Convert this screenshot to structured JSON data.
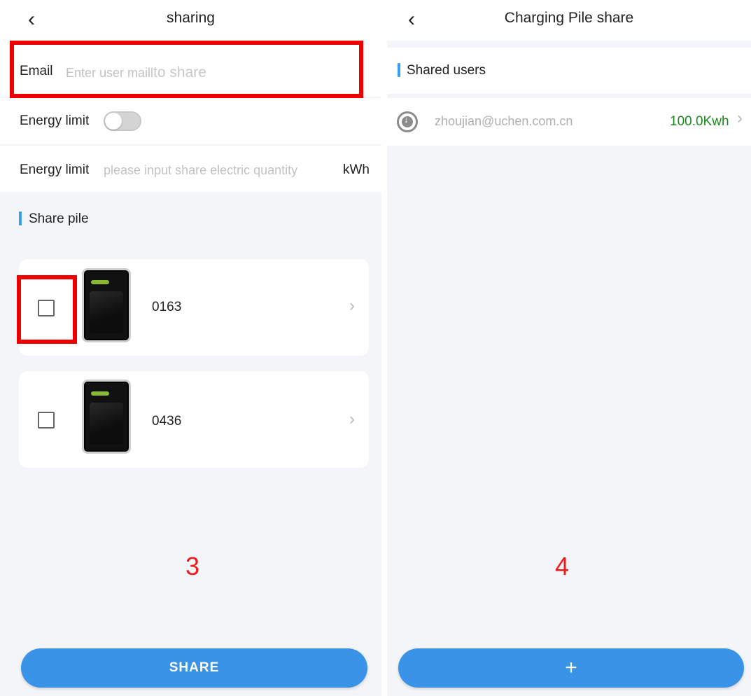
{
  "left_screen": {
    "nav": {
      "back_icon": "chevron-left-icon",
      "title": "sharing"
    },
    "email": {
      "label": "Email",
      "placeholder_small": "Enter user maill",
      "placeholder_large": "to share"
    },
    "energy_toggle": {
      "label": "Energy limit",
      "on": false
    },
    "energy_input": {
      "label": "Energy limit",
      "placeholder": "please input share electric quantity",
      "unit": "kWh"
    },
    "section_title": "Share pile",
    "piles": [
      {
        "code": "0163",
        "checked": false
      },
      {
        "code": "0436",
        "checked": false
      }
    ],
    "step_number": "3",
    "share_button": "SHARE"
  },
  "right_screen": {
    "nav": {
      "back_icon": "chevron-left-icon",
      "title": "Charging Pile share"
    },
    "section_title": "Shared users",
    "users": [
      {
        "icon": "plug-icon",
        "email": "zhoujian@uchen.com.cn",
        "energy": "100.0Kwh"
      }
    ],
    "step_number": "4",
    "add_button": "+"
  },
  "colors": {
    "accent_blue": "#3a93e6",
    "highlight_red": "#ee0000",
    "energy_green": "#1a8a1a",
    "background": "#f3f5f9"
  }
}
